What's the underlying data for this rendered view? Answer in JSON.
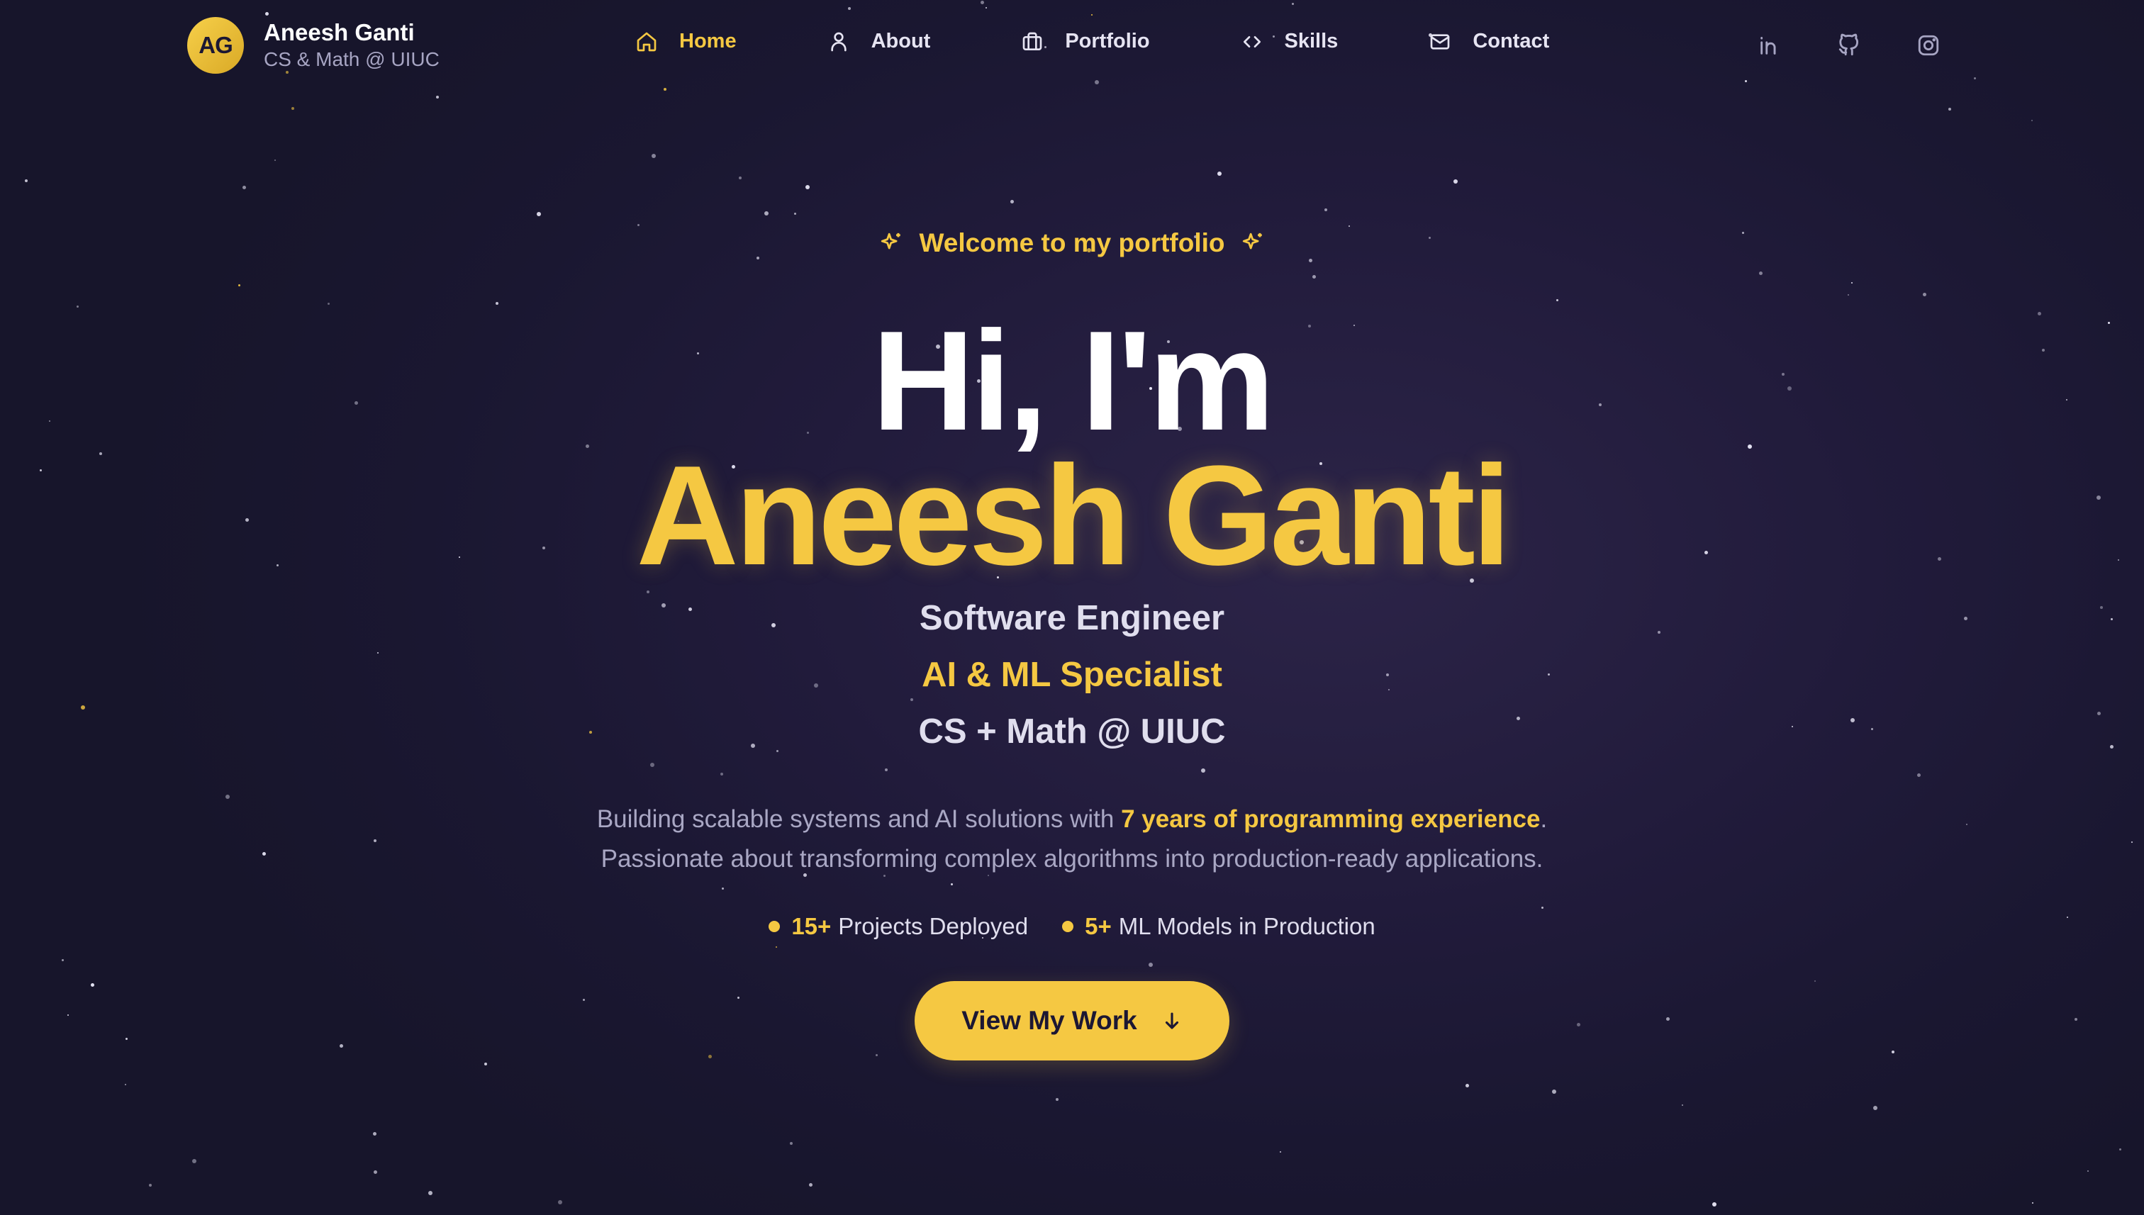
{
  "brand": {
    "initials": "AG",
    "name": "Aneesh Ganti",
    "subtitle": "CS & Math @ UIUC"
  },
  "nav": {
    "items": [
      {
        "label": "Home",
        "icon": "home-icon",
        "active": true
      },
      {
        "label": "About",
        "icon": "user-icon",
        "active": false
      },
      {
        "label": "Portfolio",
        "icon": "briefcase-icon",
        "active": false
      },
      {
        "label": "Skills",
        "icon": "code-icon",
        "active": false
      },
      {
        "label": "Contact",
        "icon": "mail-icon",
        "active": false
      }
    ],
    "social": [
      {
        "icon": "linkedin-icon"
      },
      {
        "icon": "github-icon"
      },
      {
        "icon": "instagram-icon"
      }
    ]
  },
  "hero": {
    "welcome": "Welcome to my portfolio",
    "greeting": "Hi, I'm",
    "name": "Aneesh Ganti",
    "roles": [
      "Software Engineer",
      "AI & ML Specialist",
      "CS + Math @ UIUC"
    ],
    "description_line1_pre": "Building scalable systems and AI solutions with ",
    "description_line1_highlight": "7 years of programming experience",
    "description_line1_post": ".",
    "description_line2": "Passionate about transforming complex algorithms into production-ready applications.",
    "stats": [
      {
        "number": "15+",
        "label": "Projects Deployed"
      },
      {
        "number": "5+",
        "label": "ML Models in Production"
      }
    ],
    "cta_label": "View My Work"
  },
  "colors": {
    "accent": "#f5c842",
    "background": "#211b3b",
    "text_muted": "#a9a7c4"
  }
}
